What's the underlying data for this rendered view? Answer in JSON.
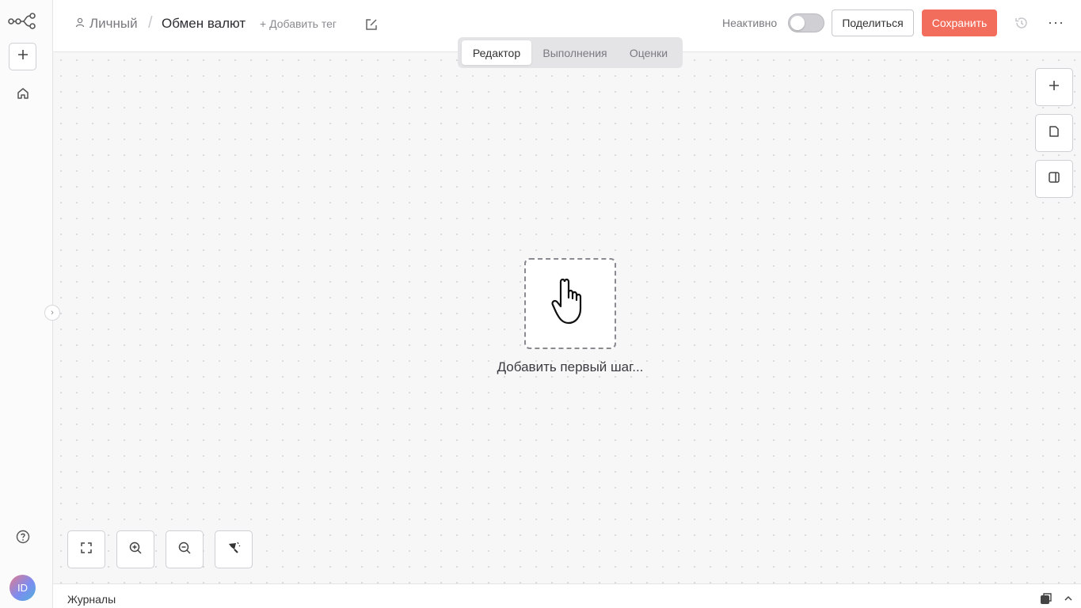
{
  "sidebar": {
    "logo_icon": "n8n-logo-icon",
    "add_icon": "plus-icon",
    "home_icon": "home-icon",
    "help_icon": "help-circle-icon",
    "avatar_initials": "ID",
    "collapse_icon": "chevron-right-icon"
  },
  "header": {
    "project_icon": "user-icon",
    "project": "Личный",
    "separator": "/",
    "workflow_name": "Обмен валют",
    "add_tag": "+ Добавить тег",
    "status_label": "Неактивно",
    "active": false,
    "share_label": "Поделиться",
    "save_label": "Сохранить",
    "more_label": "···"
  },
  "tabs": [
    {
      "label": "Редактор",
      "active": true
    },
    {
      "label": "Выполнения",
      "active": false
    },
    {
      "label": "Оценки",
      "active": false
    }
  ],
  "canvas": {
    "add_first_step": "Добавить первый шаг...",
    "hand_icon": "hand-pointer-icon",
    "right_tools": [
      "plus-icon",
      "sticky-note-icon",
      "panel-icon"
    ],
    "zoom_tools": [
      "fit-view-icon",
      "zoom-in-icon",
      "zoom-out-icon",
      "tidy-up-icon"
    ]
  },
  "logs": {
    "label": "Журналы"
  },
  "colors": {
    "accent": "#f26d5b",
    "canvas_bg": "#f7f7f8"
  }
}
